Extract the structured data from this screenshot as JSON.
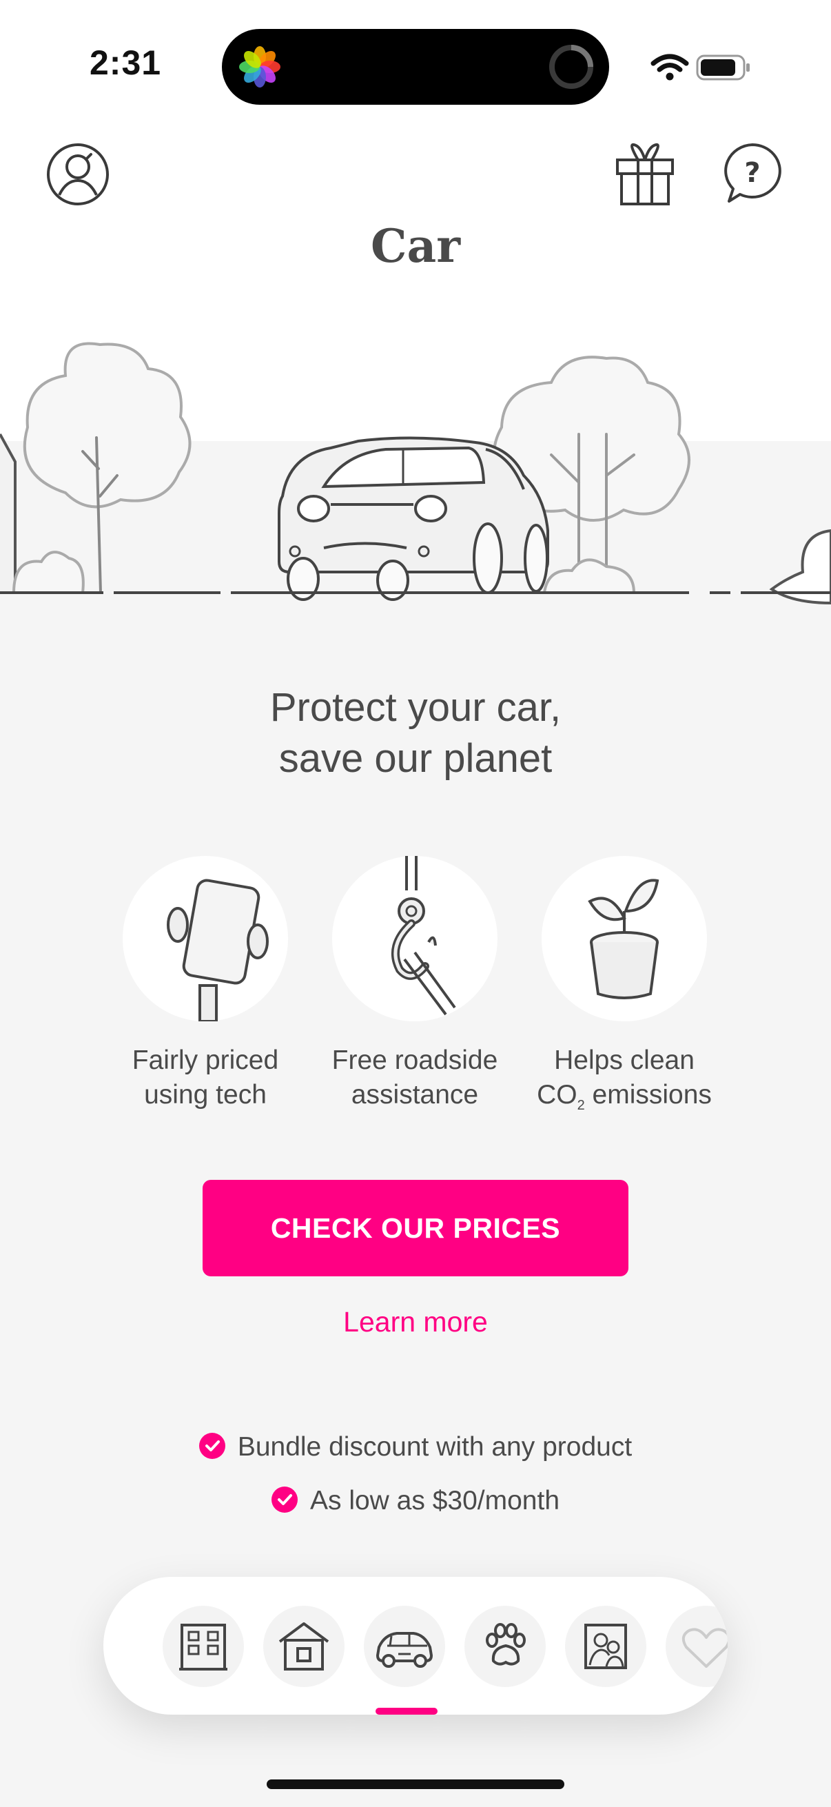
{
  "status_bar": {
    "time": "2:31"
  },
  "header": {
    "title": "Car"
  },
  "hero": {
    "headline_line1": "Protect your car,",
    "headline_line2": "save our planet"
  },
  "features": [
    {
      "line1": "Fairly priced",
      "line2": "using tech",
      "icon": "phone-in-hands-icon"
    },
    {
      "line1": "Free roadside",
      "line2": "assistance",
      "icon": "tow-hook-icon"
    },
    {
      "line1": "Helps clean",
      "line2_pre": "CO",
      "line2_sub": "2",
      "line2_post": " emissions",
      "icon": "plant-pot-icon"
    }
  ],
  "cta": {
    "label": "CHECK OUR PRICES"
  },
  "learn_more": "Learn more",
  "benefits": [
    "Bundle discount with any product",
    "As low as $30/month"
  ],
  "tabs": [
    {
      "name": "renters",
      "icon": "apartment-building-icon"
    },
    {
      "name": "home",
      "icon": "house-icon"
    },
    {
      "name": "car",
      "icon": "car-icon",
      "selected": true
    },
    {
      "name": "pet",
      "icon": "paw-icon"
    },
    {
      "name": "life",
      "icon": "family-photo-icon"
    },
    {
      "name": "more",
      "icon": "heart-icon"
    }
  ],
  "colors": {
    "accent": "#ff0083",
    "text": "#4a4a4a",
    "background": "#f5f5f5"
  }
}
